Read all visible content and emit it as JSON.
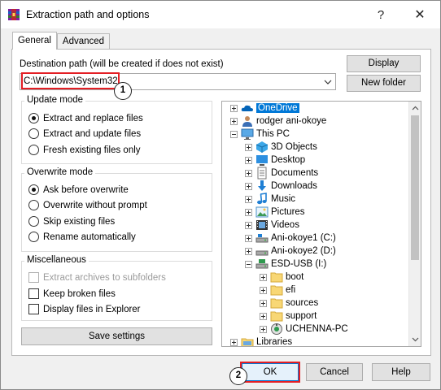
{
  "window": {
    "title": "Extraction path and options",
    "help_glyph": "?",
    "close_glyph": "✕"
  },
  "tabs": [
    {
      "label": "General",
      "active": true
    },
    {
      "label": "Advanced",
      "active": false
    }
  ],
  "destination": {
    "label": "Destination path (will be created if does not exist)",
    "value": "C:\\Windows\\System32",
    "callout": "1"
  },
  "buttons": {
    "display": "Display",
    "new_folder": "New folder",
    "save_settings": "Save settings",
    "ok": "OK",
    "cancel": "Cancel",
    "help": "Help",
    "ok_callout": "2"
  },
  "update_mode": {
    "title": "Update mode",
    "options": [
      {
        "label": "Extract and replace files",
        "checked": true
      },
      {
        "label": "Extract and update files",
        "checked": false
      },
      {
        "label": "Fresh existing files only",
        "checked": false
      }
    ]
  },
  "overwrite_mode": {
    "title": "Overwrite mode",
    "options": [
      {
        "label": "Ask before overwrite",
        "checked": true
      },
      {
        "label": "Overwrite without prompt",
        "checked": false
      },
      {
        "label": "Skip existing files",
        "checked": false
      },
      {
        "label": "Rename automatically",
        "checked": false
      }
    ]
  },
  "miscellaneous": {
    "title": "Miscellaneous",
    "options": [
      {
        "label": "Extract archives to subfolders",
        "checked": false,
        "disabled": true
      },
      {
        "label": "Keep broken files",
        "checked": false,
        "disabled": false
      },
      {
        "label": "Display files in Explorer",
        "checked": false,
        "disabled": false
      }
    ]
  },
  "tree": [
    {
      "label": "OneDrive",
      "icon": "onedrive-cloud-icon",
      "selected": true
    },
    {
      "label": "rodger ani-okoye",
      "icon": "user-folder-icon",
      "selected": false
    },
    {
      "label": "This PC",
      "icon": "computer-icon",
      "selected": false
    },
    {
      "label": "3D Objects",
      "icon": "3d-objects-icon",
      "selected": false
    },
    {
      "label": "Desktop",
      "icon": "desktop-icon",
      "selected": false
    },
    {
      "label": "Documents",
      "icon": "documents-icon",
      "selected": false
    },
    {
      "label": "Downloads",
      "icon": "downloads-icon",
      "selected": false
    },
    {
      "label": "Music",
      "icon": "music-icon",
      "selected": false
    },
    {
      "label": "Pictures",
      "icon": "pictures-icon",
      "selected": false
    },
    {
      "label": "Videos",
      "icon": "videos-icon",
      "selected": false
    },
    {
      "label": "Ani-okoye1 (C:)",
      "icon": "drive-icon",
      "selected": false
    },
    {
      "label": "Ani-okoye2 (D:)",
      "icon": "drive-icon",
      "selected": false
    },
    {
      "label": "ESD-USB (I:)",
      "icon": "usb-drive-icon",
      "selected": false
    },
    {
      "label": "boot",
      "icon": "folder-icon",
      "selected": false
    },
    {
      "label": "efi",
      "icon": "folder-icon",
      "selected": false
    },
    {
      "label": "sources",
      "icon": "folder-icon",
      "selected": false
    },
    {
      "label": "support",
      "icon": "folder-icon",
      "selected": false
    },
    {
      "label": "UCHENNA-PC",
      "icon": "network-pc-icon",
      "selected": false
    },
    {
      "label": "Libraries",
      "icon": "libraries-icon",
      "selected": false
    }
  ],
  "colors": {
    "selection": "#0078d7",
    "highlight": "#e31e24",
    "ok_border": "#0078d7"
  }
}
